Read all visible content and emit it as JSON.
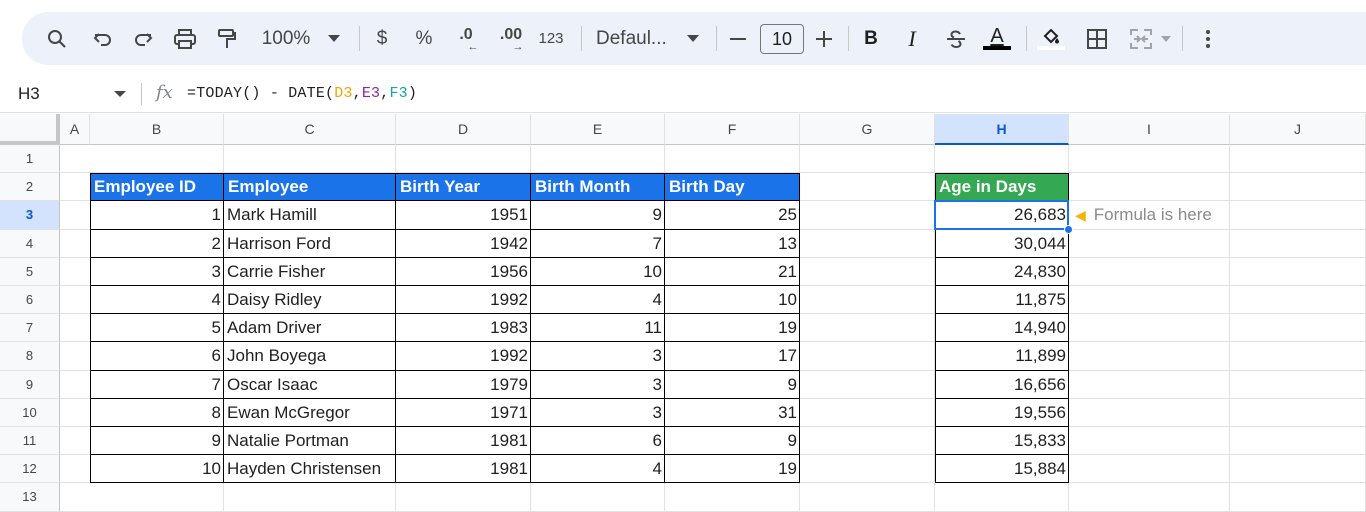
{
  "toolbar": {
    "zoom": "100%",
    "currency": "$",
    "percent": "%",
    "decrease_decimal": ".0",
    "increase_decimal": ".00",
    "more_formats": "123",
    "font": "Defaul...",
    "font_size": "10",
    "bold": "B",
    "italic": "I",
    "text_color_letter": "A",
    "icons": [
      "search-icon",
      "undo-icon",
      "redo-icon",
      "print-icon",
      "paint-format-icon",
      "zoom-dropdown-icon",
      "font-dropdown-icon",
      "minus-icon",
      "plus-icon",
      "strikethrough-icon",
      "fill-color-icon",
      "borders-icon",
      "merge-cells-icon",
      "more-vert-icon"
    ]
  },
  "formula_bar": {
    "name_box": "H3",
    "fx": "fx",
    "formula_prefix": "=TODAY() - DATE(",
    "ref1": "D3",
    "comma1": ",",
    "ref2": "E3",
    "comma2": ",",
    "ref3": "F3",
    "formula_suffix": ")"
  },
  "columns": [
    "A",
    "B",
    "C",
    "D",
    "E",
    "F",
    "G",
    "H",
    "I",
    "J"
  ],
  "rows": [
    "1",
    "2",
    "3",
    "4",
    "5",
    "6",
    "7",
    "8",
    "9",
    "10",
    "11",
    "12",
    "13"
  ],
  "selected_cell": "H3",
  "table": {
    "headers": [
      "Employee ID",
      "Employee",
      "Birth Year",
      "Birth Month",
      "Birth Day"
    ],
    "rows": [
      [
        "1",
        "Mark Hamill",
        "1951",
        "9",
        "25"
      ],
      [
        "2",
        "Harrison Ford",
        "1942",
        "7",
        "13"
      ],
      [
        "3",
        "Carrie Fisher",
        "1956",
        "10",
        "21"
      ],
      [
        "4",
        "Daisy Ridley",
        "1992",
        "4",
        "10"
      ],
      [
        "5",
        "Adam Driver",
        "1983",
        "11",
        "19"
      ],
      [
        "6",
        "John Boyega",
        "1992",
        "3",
        "17"
      ],
      [
        "7",
        "Oscar Isaac",
        "1979",
        "3",
        "9"
      ],
      [
        "8",
        "Ewan McGregor",
        "1971",
        "3",
        "31"
      ],
      [
        "9",
        "Natalie Portman",
        "1981",
        "6",
        "9"
      ],
      [
        "10",
        "Hayden Christensen",
        "1981",
        "4",
        "19"
      ]
    ],
    "header_color": "#1a73e8"
  },
  "age": {
    "header": "Age in Days",
    "header_color": "#34a853",
    "values": [
      "26,683",
      "30,044",
      "24,830",
      "11,875",
      "14,940",
      "11,899",
      "16,656",
      "19,556",
      "15,833",
      "15,884"
    ]
  },
  "note": "Formula is here"
}
